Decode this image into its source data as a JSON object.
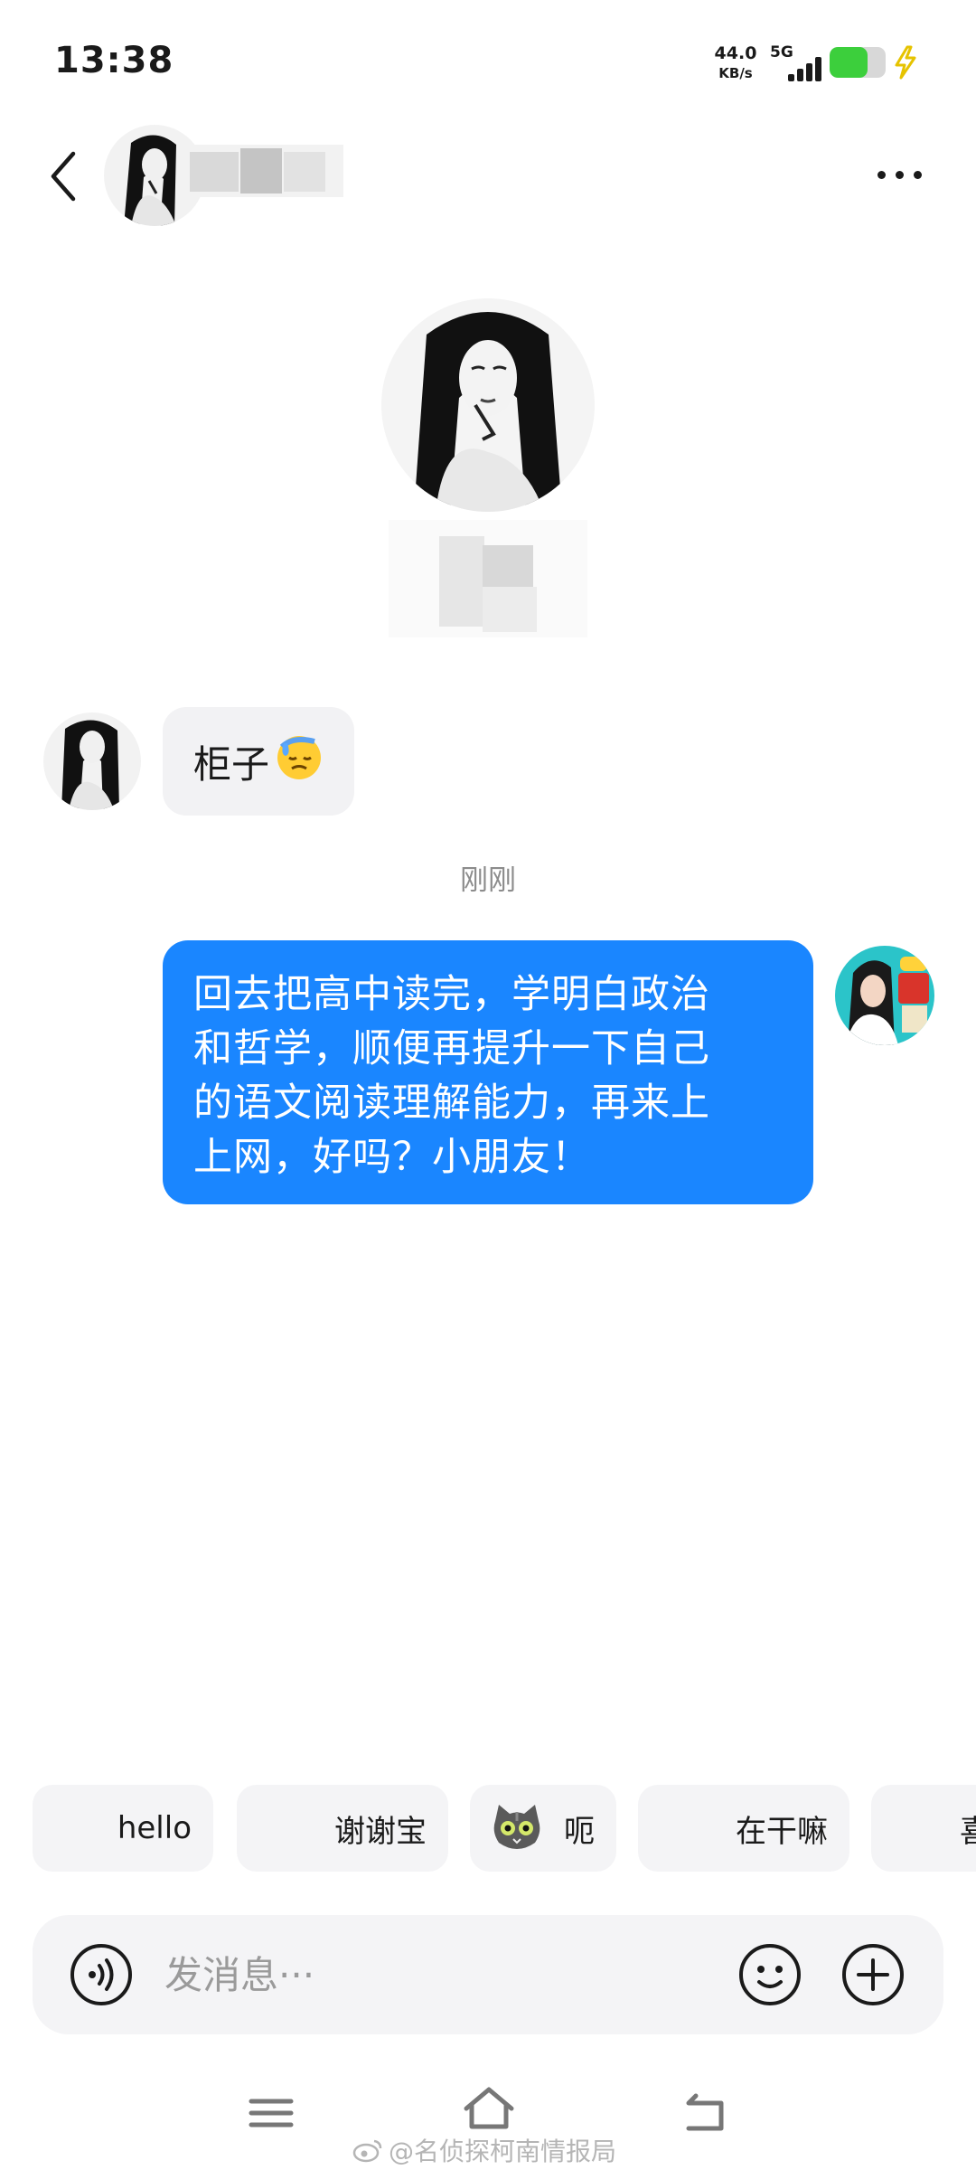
{
  "status_bar": {
    "time": "13:38",
    "net_speed_value": "44.0",
    "net_speed_unit": "KB/s",
    "network_type": "5G",
    "battery_percent": 68,
    "battery_color": "#3ccf3c",
    "charging": true
  },
  "header": {
    "back_icon": "chevron-left-icon",
    "more_icon": "more-dots-icon"
  },
  "messages": [
    {
      "side": "left",
      "text": "柜子",
      "emoji": "😓"
    },
    {
      "type": "timestamp",
      "text": "刚刚"
    },
    {
      "side": "right",
      "text_lines": [
        "回去把高中读完，学明白政治",
        "和哲学，顺便再提升一下自己",
        "的语文阅读理解能力，再来上",
        "上网，好吗？小朋友！"
      ]
    }
  ],
  "quick_replies": [
    "hello",
    "谢谢宝",
    "呃",
    "在干嘛",
    "喜"
  ],
  "input": {
    "placeholder": "发消息···"
  },
  "watermark": "@名侦探柯南情报局",
  "colors": {
    "sent_bubble": "#1a86ff",
    "received_bubble": "#f2f2f4",
    "timestamp": "#8c8c8c"
  }
}
